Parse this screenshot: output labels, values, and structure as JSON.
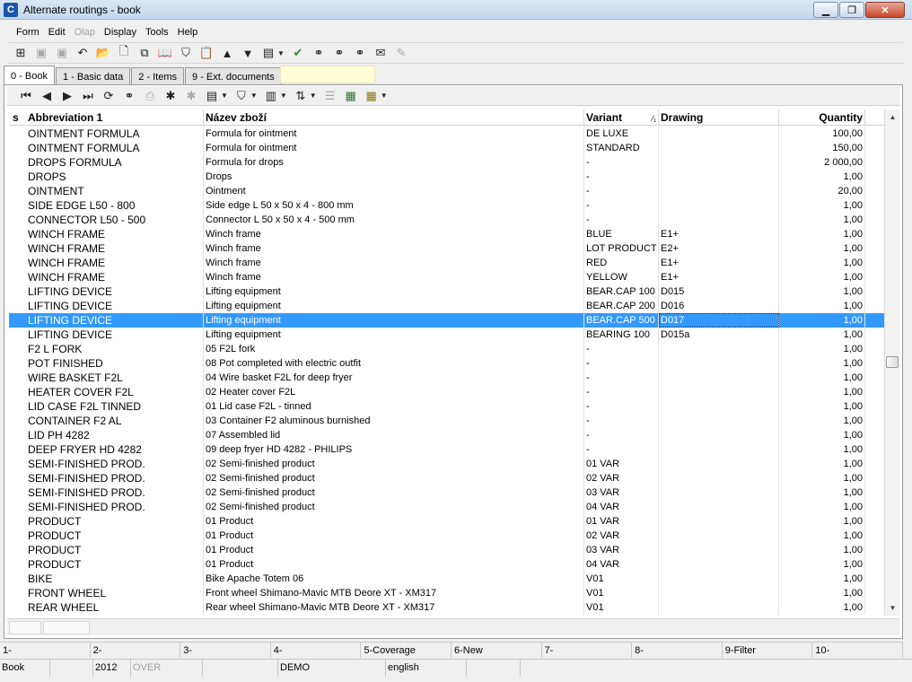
{
  "window": {
    "title": "Alternate routings - book",
    "app_icon": "C"
  },
  "menu": [
    "Form",
    "Edit",
    "Olap",
    "Display",
    "Tools",
    "Help"
  ],
  "menu_disabled": [
    "Olap"
  ],
  "tabs": [
    "0 - Book",
    "1 - Basic data",
    "2 - Items",
    "9 - Ext. documents"
  ],
  "columns": {
    "s": "s",
    "abbr": "Abbreviation 1",
    "name": "Název zboží",
    "variant": "Variant",
    "sort": "⁄₁",
    "drawing": "Drawing",
    "qty": "Quantity"
  },
  "rows": [
    {
      "abbr": "OINTMENT FORMULA",
      "name": "Formula for ointment",
      "variant": "DE LUXE",
      "drawing": "",
      "qty": "100,00"
    },
    {
      "abbr": "OINTMENT FORMULA",
      "name": "Formula for ointment",
      "variant": "STANDARD",
      "drawing": "",
      "qty": "150,00"
    },
    {
      "abbr": "DROPS FORMULA",
      "name": "Formula for drops",
      "variant": "-",
      "drawing": "",
      "qty": "2 000,00"
    },
    {
      "abbr": "DROPS",
      "name": "Drops",
      "variant": "-",
      "drawing": "",
      "qty": "1,00"
    },
    {
      "abbr": "OINTMENT",
      "name": "Ointment",
      "variant": "-",
      "drawing": "",
      "qty": "20,00"
    },
    {
      "abbr": "SIDE EDGE L50 - 800",
      "name": "Side edge L 50 x 50 x 4 - 800 mm",
      "variant": "-",
      "drawing": "",
      "qty": "1,00"
    },
    {
      "abbr": "CONNECTOR L50 - 500",
      "name": "Connector L 50 x 50 x 4 - 500 mm",
      "variant": "-",
      "drawing": "",
      "qty": "1,00"
    },
    {
      "abbr": "WINCH FRAME",
      "name": "Winch frame",
      "variant": "BLUE",
      "drawing": "E1+",
      "qty": "1,00"
    },
    {
      "abbr": "WINCH FRAME",
      "name": "Winch frame",
      "variant": "LOT PRODUCT",
      "drawing": "E2+",
      "qty": "1,00"
    },
    {
      "abbr": "WINCH FRAME",
      "name": "Winch frame",
      "variant": "RED",
      "drawing": "E1+",
      "qty": "1,00"
    },
    {
      "abbr": "WINCH FRAME",
      "name": "Winch frame",
      "variant": "YELLOW",
      "drawing": "E1+",
      "qty": "1,00"
    },
    {
      "abbr": "LIFTING DEVICE",
      "name": "Lifting equipment",
      "variant": "BEAR.CAP 100",
      "drawing": "D015",
      "qty": "1,00"
    },
    {
      "abbr": "LIFTING DEVICE",
      "name": "Lifting equipment",
      "variant": "BEAR.CAP 200",
      "drawing": "D016",
      "qty": "1,00"
    },
    {
      "abbr": "LIFTING DEVICE",
      "name": "Lifting equipment",
      "variant": "BEAR.CAP 500",
      "drawing": "D017",
      "qty": "1,00",
      "selected": true
    },
    {
      "abbr": "LIFTING DEVICE",
      "name": "Lifting equipment",
      "variant": "BEARING 100",
      "drawing": "D015a",
      "qty": "1,00"
    },
    {
      "abbr": "F2 L FORK",
      "name": "05 F2L fork",
      "variant": "-",
      "drawing": "",
      "qty": "1,00"
    },
    {
      "abbr": "POT FINISHED",
      "name": "08 Pot completed with electric outfit",
      "variant": "-",
      "drawing": "",
      "qty": "1,00"
    },
    {
      "abbr": "WIRE BASKET F2L",
      "name": "04 Wire basket F2L for deep fryer",
      "variant": "-",
      "drawing": "",
      "qty": "1,00"
    },
    {
      "abbr": "HEATER COVER F2L",
      "name": "02 Heater cover F2L",
      "variant": "-",
      "drawing": "",
      "qty": "1,00"
    },
    {
      "abbr": "LID CASE F2L TINNED",
      "name": "01 Lid case F2L - tinned",
      "variant": "-",
      "drawing": "",
      "qty": "1,00"
    },
    {
      "abbr": "CONTAINER F2 AL",
      "name": "03 Container F2 aluminous burnished",
      "variant": "-",
      "drawing": "",
      "qty": "1,00"
    },
    {
      "abbr": "LID PH 4282",
      "name": "07 Assembled lid",
      "variant": "-",
      "drawing": "",
      "qty": "1,00"
    },
    {
      "abbr": "DEEP FRYER HD 4282",
      "name": "09 deep fryer HD 4282 - PHILIPS",
      "variant": "-",
      "drawing": "",
      "qty": "1,00"
    },
    {
      "abbr": "SEMI-FINISHED PROD.",
      "name": "02 Semi-finished product",
      "variant": "01 VAR",
      "drawing": "",
      "qty": "1,00"
    },
    {
      "abbr": "SEMI-FINISHED PROD.",
      "name": "02 Semi-finished product",
      "variant": "02 VAR",
      "drawing": "",
      "qty": "1,00"
    },
    {
      "abbr": "SEMI-FINISHED PROD.",
      "name": "02 Semi-finished product",
      "variant": "03 VAR",
      "drawing": "",
      "qty": "1,00"
    },
    {
      "abbr": "SEMI-FINISHED PROD.",
      "name": "02 Semi-finished product",
      "variant": "04 VAR",
      "drawing": "",
      "qty": "1,00"
    },
    {
      "abbr": "PRODUCT",
      "name": "01 Product",
      "variant": "01 VAR",
      "drawing": "",
      "qty": "1,00"
    },
    {
      "abbr": "PRODUCT",
      "name": "01 Product",
      "variant": "02 VAR",
      "drawing": "",
      "qty": "1,00"
    },
    {
      "abbr": "PRODUCT",
      "name": "01 Product",
      "variant": "03 VAR",
      "drawing": "",
      "qty": "1,00"
    },
    {
      "abbr": "PRODUCT",
      "name": "01 Product",
      "variant": "04 VAR",
      "drawing": "",
      "qty": "1,00"
    },
    {
      "abbr": "BIKE",
      "name": "Bike Apache Totem 06",
      "variant": "V01",
      "drawing": "",
      "qty": "1,00"
    },
    {
      "abbr": "FRONT WHEEL",
      "name": "Front wheel Shimano-Mavic MTB Deore XT - XM317",
      "variant": "V01",
      "drawing": "",
      "qty": "1,00"
    },
    {
      "abbr": "REAR WHEEL",
      "name": "Rear wheel Shimano-Mavic MTB Deore XT - XM317",
      "variant": "V01",
      "drawing": "",
      "qty": "1,00"
    }
  ],
  "fkeys": [
    "1-",
    "2-",
    "3-",
    "4-",
    "5-Coverage",
    "6-New",
    "7-",
    "8-",
    "9-Filter",
    "10-"
  ],
  "status": [
    {
      "text": "Book",
      "w": 56
    },
    {
      "text": "",
      "w": 48
    },
    {
      "text": "2012",
      "w": 42
    },
    {
      "text": "OVER",
      "w": 80,
      "dim": true
    },
    {
      "text": "",
      "w": 84
    },
    {
      "text": "DEMO",
      "w": 120
    },
    {
      "text": "english",
      "w": 90
    },
    {
      "text": "",
      "w": 60
    }
  ],
  "toolbar_icons": [
    "tree-icon",
    "save-icon",
    "save-as-icon",
    "undo-icon",
    "open-folder-icon",
    "new-document-icon",
    "copy-document-icon",
    "book-icon",
    "filter-icon",
    "paste-icon",
    "arrow-up-icon",
    "arrow-down-icon",
    "image-icon",
    "check-icon",
    "binoculars-icon",
    "binoculars-next-icon",
    "binoculars-key-icon",
    "mail-icon",
    "edit-icon"
  ],
  "toolbar2_icons": [
    "first-record-icon",
    "prev-record-icon",
    "next-record-icon",
    "last-record-icon",
    "refresh-icon",
    "find-icon",
    "print-icon",
    "mark-icon",
    "unmark-icon",
    "image-icon",
    "filter-icon",
    "columns-icon",
    "sort-icon",
    "list-icon",
    "excel-icon",
    "report-icon"
  ]
}
